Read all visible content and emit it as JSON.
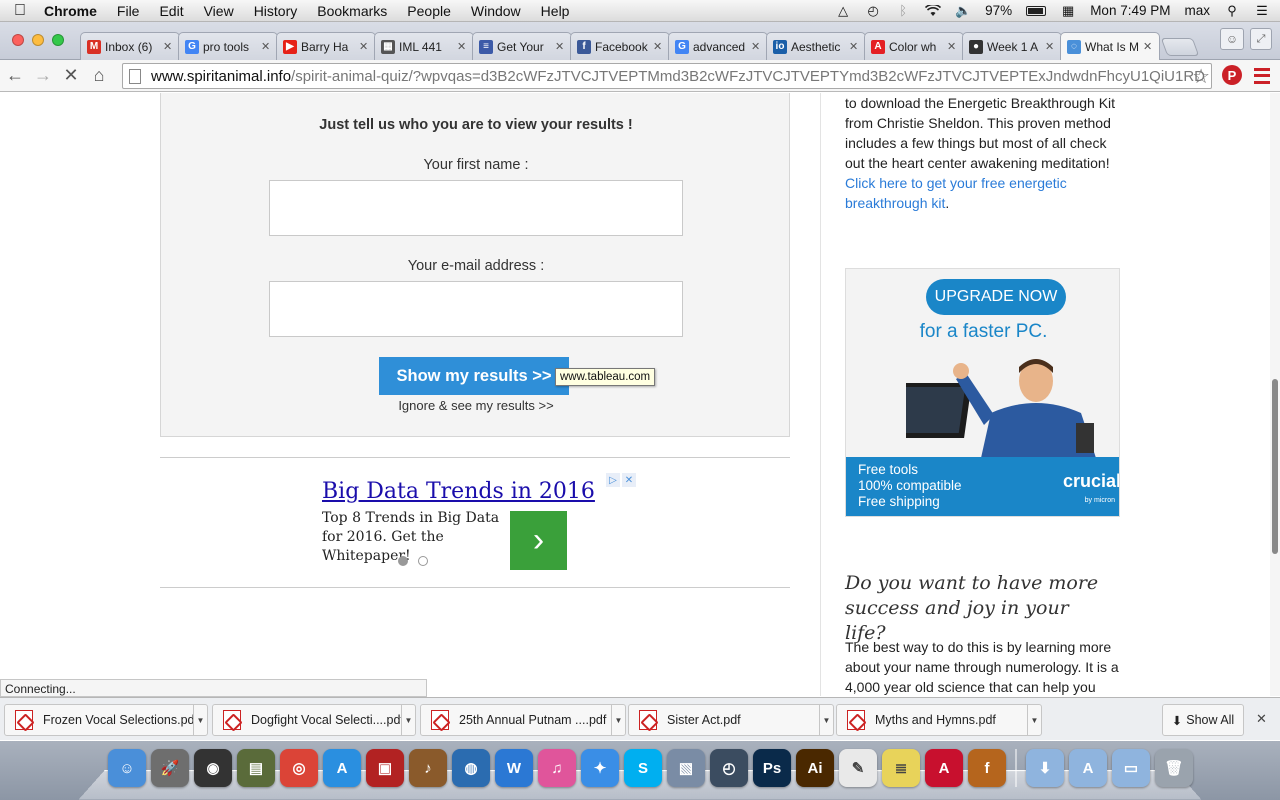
{
  "menubar": {
    "app_name": "Chrome",
    "items": [
      "File",
      "Edit",
      "View",
      "History",
      "Bookmarks",
      "People",
      "Window",
      "Help"
    ],
    "battery": "97%",
    "clock": "Mon 7:49 PM",
    "user": "max",
    "icons": [
      "adobe-icon",
      "time-machine-icon",
      "bluetooth-icon",
      "wifi-icon",
      "volume-icon",
      "battery-icon",
      "calendar-icon",
      "spotlight-icon",
      "notification-center-icon"
    ]
  },
  "tabs": [
    {
      "label": "Inbox (6)",
      "icon": "gmail-icon",
      "color": "#d93025",
      "glyph": "M"
    },
    {
      "label": "pro tools",
      "icon": "google-icon",
      "color": "#4285f4",
      "glyph": "G"
    },
    {
      "label": "Barry Ha",
      "icon": "youtube-icon",
      "color": "#e62117",
      "glyph": "▶"
    },
    {
      "label": "IML 441",
      "icon": "grid-icon",
      "color": "#555555",
      "glyph": "▦"
    },
    {
      "label": "Get Your",
      "icon": "flag-icon",
      "color": "#3c5aa8",
      "glyph": "≡"
    },
    {
      "label": "Facebook",
      "icon": "facebook-icon",
      "color": "#3b5998",
      "glyph": "f"
    },
    {
      "label": "advanced",
      "icon": "google-icon",
      "color": "#4285f4",
      "glyph": "G"
    },
    {
      "label": "Aesthetic",
      "icon": "iol-icon",
      "color": "#1a5fa8",
      "glyph": "io"
    },
    {
      "label": "Color wh",
      "icon": "adobe-icon",
      "color": "#e41f24",
      "glyph": "A"
    },
    {
      "label": "Week 1 A",
      "icon": "github-icon",
      "color": "#333333",
      "glyph": "●"
    },
    {
      "label": "What Is M",
      "icon": "loading-icon",
      "color": "#4a90d9",
      "glyph": "◌"
    }
  ],
  "toolbar": {
    "url_host": "www.spiritanimal.info",
    "url_path": "/spirit-animal-quiz/?wpvqas=d3B2cWFzJTVCJTVEPTMmd3B2cWFzJTVCJTVEPTYmd3B2cWFzJTVCJTVEPTExJndwdnFhcyU1QiU1RD..."
  },
  "quiz": {
    "heading": "Just tell us who you are to view your results !",
    "first_name_label": "Your first name :",
    "email_label": "Your e-mail address :",
    "first_name_value": "",
    "email_value": "",
    "submit_label": "Show my results >>",
    "ignore_label": "Ignore & see my results >>",
    "tooltip": "www.tableau.com"
  },
  "bigdata_ad": {
    "title": "Big Data Trends in 2016",
    "text": "Top 8 Trends in Big Data for 2016. Get the Whitepaper!",
    "arrow": "›",
    "adchoices": [
      "▷",
      "✕"
    ]
  },
  "sidebar": {
    "intro_text": "to download the Energetic Breakthrough Kit from Christie Sheldon. This proven method includes a few things but most of all check out the heart center awakening meditation!",
    "link_text": "Click here to get your free energetic breakthrough kit",
    "link_after": ".",
    "crucial_ad": {
      "button": "UPGRADE NOW",
      "tagline": "for a faster PC.",
      "features": [
        "Free tools",
        "100% compatible",
        "Free shipping"
      ],
      "logo": "crucial",
      "logo_sub": "by micron"
    },
    "heading": "Do you want to have more success and joy in your life?",
    "body": "The best way to do this is by learning more about your name through numerology. It is a 4,000 year old science that can help you"
  },
  "status": "Connecting...",
  "downloads": {
    "items": [
      "Frozen Vocal Selections.pdf",
      "Dogfight Vocal Selecti....pdf",
      "25th Annual Putnam ....pdf",
      "Sister Act.pdf",
      "Myths and Hymns.pdf"
    ],
    "show_all": "Show All"
  },
  "dock": [
    {
      "name": "finder-icon",
      "color": "#4a8fd9",
      "glyph": "☺"
    },
    {
      "name": "launchpad-icon",
      "color": "#6e6e6e",
      "glyph": "🚀"
    },
    {
      "name": "dashboard-icon",
      "color": "#333333",
      "glyph": "◉"
    },
    {
      "name": "mission-control-icon",
      "color": "#5a6b3a",
      "glyph": "▤"
    },
    {
      "name": "chrome-icon",
      "color": "#db4437",
      "glyph": "◎"
    },
    {
      "name": "app-store-icon",
      "color": "#2a8fe0",
      "glyph": "A"
    },
    {
      "name": "photo-booth-icon",
      "color": "#b22222",
      "glyph": "▣"
    },
    {
      "name": "garageband-icon",
      "color": "#8a5a2b",
      "glyph": "♪"
    },
    {
      "name": "google-earth-icon",
      "color": "#2b6cb0",
      "glyph": "◍"
    },
    {
      "name": "word-icon",
      "color": "#2b78d4",
      "glyph": "W"
    },
    {
      "name": "itunes-icon",
      "color": "#e0559b",
      "glyph": "♫"
    },
    {
      "name": "safari-icon",
      "color": "#3a8ee6",
      "glyph": "✦"
    },
    {
      "name": "skype-icon",
      "color": "#00aff0",
      "glyph": "S"
    },
    {
      "name": "preview-icon",
      "color": "#7a8ca5",
      "glyph": "▧"
    },
    {
      "name": "time-machine-icon",
      "color": "#3b4c60",
      "glyph": "◴"
    },
    {
      "name": "photoshop-icon",
      "color": "#0a2a4a",
      "glyph": "Ps"
    },
    {
      "name": "illustrator-icon",
      "color": "#4a2800",
      "glyph": "Ai"
    },
    {
      "name": "textedit-icon",
      "color": "#e9e9e9",
      "glyph": "✎"
    },
    {
      "name": "stickies-icon",
      "color": "#e8d35a",
      "glyph": "≣"
    },
    {
      "name": "acrobat-icon",
      "color": "#c8102e",
      "glyph": "A"
    },
    {
      "name": "fontforge-icon",
      "color": "#b5651d",
      "glyph": "f"
    },
    {
      "name": "downloads-stack-icon",
      "color": "#8fb4de",
      "glyph": "⬇"
    },
    {
      "name": "applications-folder-icon",
      "color": "#8fb4de",
      "glyph": "A"
    },
    {
      "name": "documents-folder-icon",
      "color": "#8fb4de",
      "glyph": "▭"
    },
    {
      "name": "trash-icon",
      "color": "#9aa3ad",
      "glyph": "🗑"
    }
  ]
}
